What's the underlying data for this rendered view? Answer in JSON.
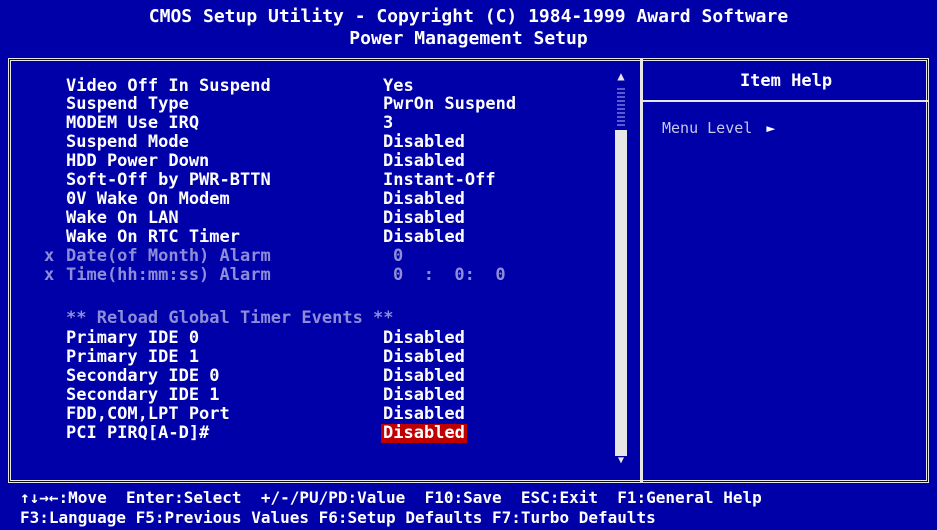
{
  "header": {
    "line1": "CMOS Setup Utility - Copyright (C) 1984-1999 Award Software",
    "line2": "Power Management Setup"
  },
  "items": [
    {
      "label": "Video Off In Suspend",
      "value": "Yes"
    },
    {
      "label": "Suspend Type",
      "value": "PwrOn Suspend"
    },
    {
      "label": "MODEM Use IRQ",
      "value": "3"
    },
    {
      "label": "Suspend Mode",
      "value": "Disabled"
    },
    {
      "label": "HDD Power Down",
      "value": "Disabled"
    },
    {
      "label": "Soft-Off by PWR-BTTN",
      "value": "Instant-Off"
    },
    {
      "label": "0V Wake On Modem",
      "value": "Disabled"
    },
    {
      "label": "Wake On LAN",
      "value": "Disabled"
    },
    {
      "label": "Wake On RTC Timer",
      "value": "Disabled"
    },
    {
      "mark": "x",
      "label": "Date(of Month) Alarm",
      "value": "0"
    },
    {
      "mark": "x",
      "label": "Time(hh:mm:ss) Alarm",
      "value": "0  :  0:  0"
    },
    {
      "label": "** Reload Global Timer Events **"
    },
    {
      "label": "Primary IDE 0",
      "value": "Disabled"
    },
    {
      "label": "Primary IDE 1",
      "value": "Disabled"
    },
    {
      "label": "Secondary IDE 0",
      "value": "Disabled"
    },
    {
      "label": "Secondary IDE 1",
      "value": "Disabled"
    },
    {
      "label": "FDD,COM,LPT Port",
      "value": "Disabled"
    },
    {
      "label": "PCI PIRQ[A-D]#",
      "value": "Disabled"
    }
  ],
  "help": {
    "title": "Item Help",
    "menu_level": "Menu Level",
    "menu_arrow": "►"
  },
  "scroll": {
    "up": "▲",
    "down": "▼"
  },
  "footer": {
    "line1": "↑↓→←:Move  Enter:Select  +/-/PU/PD:Value  F10:Save  ESC:Exit  F1:General Help",
    "line2": "F3:Language F5:Previous Values F6:Setup Defaults F7:Turbo Defaults"
  },
  "colors": {
    "background": "#0000a8",
    "text": "#ffffff",
    "disabled_text": "#8d8dd9",
    "highlight": "#c00000"
  }
}
